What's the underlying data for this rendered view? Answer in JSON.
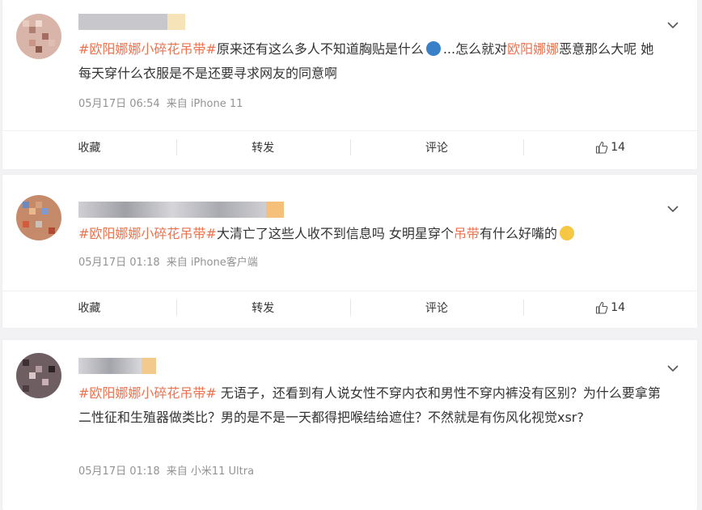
{
  "posts": [
    {
      "tag": "#欧阳娜娜小碎花吊带#",
      "text_a": "原来还有这么多人不知道胸贴是什么",
      "text_b": "...怎么就对",
      "mention": "欧阳娜娜",
      "text_c": "恶意那么大呢 她每天穿什么衣服是不是还要寻求网友的同意啊",
      "time": "05月17日 06:54",
      "source": "来自 iPhone 11",
      "actions": {
        "fav": "收藏",
        "repost": "转发",
        "comment": "评论",
        "likes": "14"
      }
    },
    {
      "tag": "#欧阳娜娜小碎花吊带#",
      "text_a": "大清亡了这些人收不到信息吗 女明星穿个",
      "keyword": "吊带",
      "text_b": "有什么好嘴的",
      "time": "05月17日 01:18",
      "source": "来自 iPhone客户端",
      "actions": {
        "fav": "收藏",
        "repost": "转发",
        "comment": "评论",
        "likes": "14"
      }
    },
    {
      "tag": "#欧阳娜娜小碎花吊带#",
      "text_a": " 无语子，还看到有人说女性不穿内衣和男性不穿内裤没有区别？为什么要拿第二性征和生殖器做类比？男的是不是一天都得把喉结给遮住？不然就是有伤风化视觉xsr?",
      "time": "05月17日 01:18",
      "source": "来自 小米11 Ultra"
    }
  ],
  "icons": {
    "menu": "chevron-down-icon",
    "like": "thumbs-up-icon"
  },
  "colors": {
    "link": "#eb7350",
    "meta": "#939393"
  }
}
